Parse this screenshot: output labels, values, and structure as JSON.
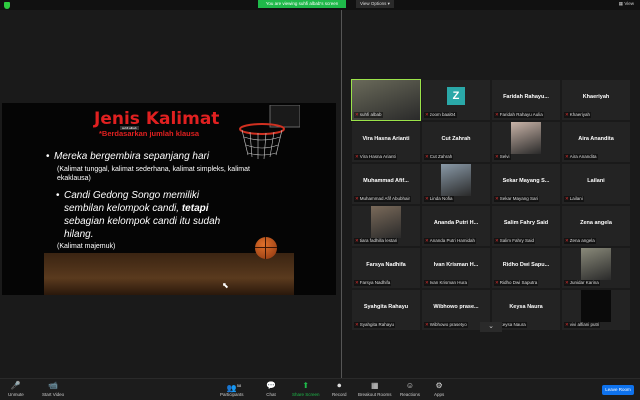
{
  "header": {
    "banner": "You are viewing suhfi albab's screen",
    "view_options": "View Options ▾",
    "view": "View"
  },
  "slide": {
    "title": "Jenis Kalimat",
    "subtitle": "*Berdasarkan jumlah klausa",
    "tag": "suhfi albab",
    "bullet1": "Mereka bergembira sepanjang hari",
    "note1": "(Kalimat tunggal, kalimat sederhana, kalimat simpleks, kalimat ekaklausa)",
    "bullet2_a": "Candi Gedong Songo memiliki sembilan kelompok candi,",
    "bullet2_bold": "tetapi",
    "bullet2_b": "sebagian kelompok candi itu sudah hilang.",
    "note2": "(Kalimat majemuk)"
  },
  "participants": [
    {
      "name": "",
      "label": "suhfi albab",
      "type": "photo",
      "active": true
    },
    {
      "name": "",
      "label": "zoom baal04",
      "type": "z"
    },
    {
      "name": "Faridah Rahayu...",
      "label": "Faridah Rahayu Aulia"
    },
    {
      "name": "Khaeriyah",
      "label": "Khaeriyah"
    },
    {
      "name": "Vira Hasna Arianti",
      "label": "Vira Hasna Arianti"
    },
    {
      "name": "Cut Zahrah",
      "label": "Cut Zahrah"
    },
    {
      "name": "",
      "label": "Selvi",
      "type": "photo"
    },
    {
      "name": "Aira Ananditа",
      "label": "Aira Ananditа"
    },
    {
      "name": "Muhammad Afif...",
      "label": "Muhammad Afif Abubhair"
    },
    {
      "name": "",
      "label": "Linda Nofia",
      "type": "photo"
    },
    {
      "name": "Sekar Mayang S...",
      "label": "Sekar Mayang Sari"
    },
    {
      "name": "Lailani",
      "label": "Lailani"
    },
    {
      "name": "",
      "label": "tiara fadhilla lestari",
      "type": "photo"
    },
    {
      "name": "Ananda Putri H...",
      "label": "Ananda Putri Hamidah"
    },
    {
      "name": "Salim Fahry Said",
      "label": "Salim Fahry Said"
    },
    {
      "name": "Zena angela",
      "label": "Zena angela"
    },
    {
      "name": "Farsya Nadhifa",
      "label": "Farsya Nadhifa"
    },
    {
      "name": "Ivan Krisman H...",
      "label": "Ivan Krisman Hura"
    },
    {
      "name": "Ridho Dwi Sapu...",
      "label": "Ridho Dwi Saputra"
    },
    {
      "name": "",
      "label": "Junidar Karina",
      "type": "photo"
    },
    {
      "name": "Syahgita Rahayu",
      "label": "Syahgita Rahayu"
    },
    {
      "name": "Wibhowo prase...",
      "label": "Wibhowo prasetyo"
    },
    {
      "name": "Keysa Naura",
      "label": "Keysa Naura"
    },
    {
      "name": "",
      "label": "vivi alfiani putri",
      "type": "dark"
    }
  ],
  "toolbar": {
    "unmute": "Unmute",
    "start_video": "Start Video",
    "participants": "Participants",
    "participants_count": "58",
    "chat": "Chat",
    "share_screen": "Share Screen",
    "record": "Record",
    "breakout_rooms": "Breakout Rooms",
    "reactions": "Reactions",
    "apps": "Apps",
    "leave": "Leave Room"
  }
}
